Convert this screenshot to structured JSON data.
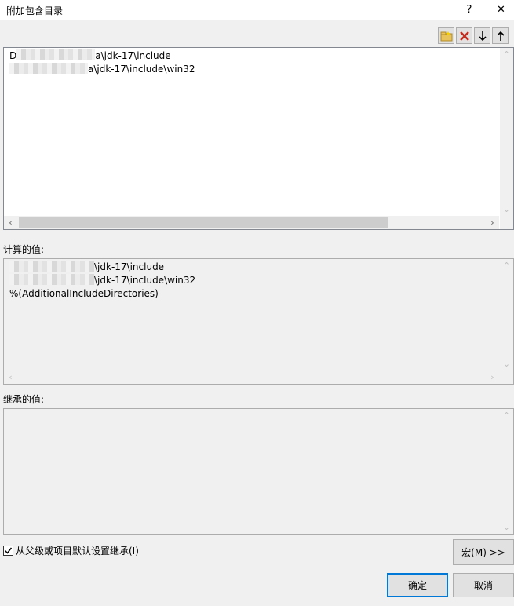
{
  "window": {
    "title": "附加包含目录",
    "help": "?",
    "close": "✕"
  },
  "toolbar": {
    "new_line_icon": "new-folder-icon",
    "delete_icon": "delete-icon",
    "move_down_icon": "arrow-down-icon",
    "move_up_icon": "arrow-up-icon"
  },
  "edit_list": {
    "items": [
      {
        "prefix": "D",
        "suffix": "a\\jdk-17\\include"
      },
      {
        "prefix": "",
        "suffix": "a\\jdk-17\\include\\win32"
      }
    ]
  },
  "evaluated": {
    "label": "计算的值:",
    "items": [
      {
        "suffix": "\\jdk-17\\include"
      },
      {
        "suffix": "\\jdk-17\\include\\win32"
      }
    ],
    "last_line": "%(AdditionalIncludeDirectories)"
  },
  "inherited": {
    "label": "继承的值:"
  },
  "inherit_checkbox": {
    "label": "从父级或项目默认设置继承(I)",
    "checked": true
  },
  "buttons": {
    "macros": "宏(M) >>",
    "ok": "确定",
    "cancel": "取消"
  }
}
